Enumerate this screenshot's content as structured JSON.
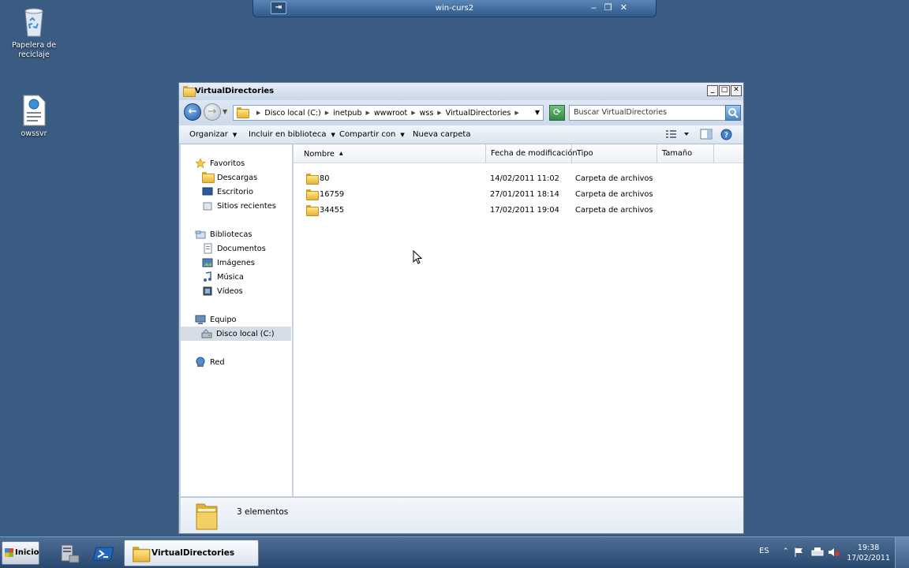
{
  "desktop": {
    "icons": [
      {
        "label": "Papelera de reciclaje",
        "icon": "recycle-bin-icon"
      },
      {
        "label": "owssvr",
        "icon": "xml-document-icon"
      }
    ]
  },
  "rdp_bar": {
    "title": "win-curs2",
    "pin": "pin-icon",
    "buttons": [
      "minimize-icon",
      "restore-icon",
      "close-icon"
    ]
  },
  "window": {
    "title": "VirtualDirectories",
    "controls": [
      "minimize",
      "maximize",
      "close"
    ],
    "address": {
      "crumbs": [
        "Disco local (C:)",
        "inetpub",
        "wwwroot",
        "wss",
        "VirtualDirectories"
      ]
    },
    "search": {
      "placeholder": "Buscar VirtualDirectories"
    },
    "toolbar": {
      "organize": "Organizar",
      "include": "Incluir en biblioteca",
      "share": "Compartir con",
      "new_folder": "Nueva carpeta"
    },
    "nav": {
      "favorites": "Favoritos",
      "downloads": "Descargas",
      "desktop": "Escritorio",
      "recent": "Sitios recientes",
      "libraries": "Bibliotecas",
      "documents": "Documentos",
      "pictures": "Imágenes",
      "music": "Música",
      "videos": "Vídeos",
      "computer": "Equipo",
      "local_disk": "Disco local (C:)",
      "network": "Red"
    },
    "columns": {
      "name": "Nombre",
      "modified": "Fecha de modificación",
      "type": "Tipo",
      "size": "Tamaño"
    },
    "files": [
      {
        "name": "80",
        "modified": "14/02/2011 11:02",
        "type": "Carpeta de archivos",
        "size": ""
      },
      {
        "name": "16759",
        "modified": "27/01/2011 18:14",
        "type": "Carpeta de archivos",
        "size": ""
      },
      {
        "name": "34455",
        "modified": "17/02/2011 19:04",
        "type": "Carpeta de archivos",
        "size": ""
      }
    ],
    "details": {
      "count": "3 elementos"
    }
  },
  "taskbar": {
    "start": "Inicio",
    "active_task": "VirtualDirectories",
    "language": "ES",
    "time": "19:38",
    "date": "17/02/2011"
  }
}
